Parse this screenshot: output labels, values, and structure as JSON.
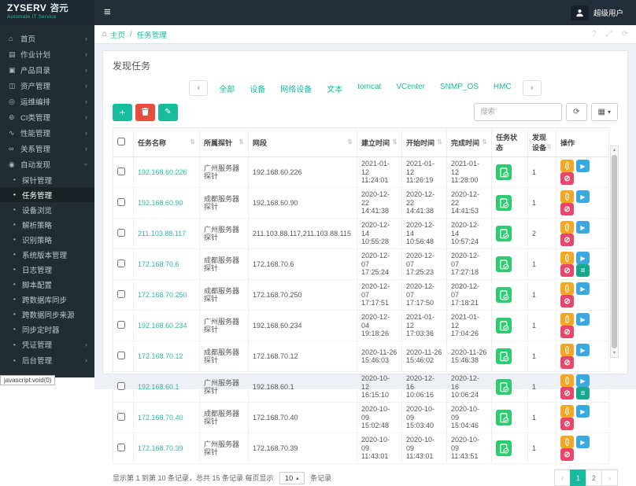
{
  "colors": {
    "accent": "#18bc9c",
    "link_teal": "#2fb9a4",
    "topbar_bg": "#232f38",
    "sidebar_bg": "#222d32",
    "content_bg": "#edf0f5",
    "danger_red": "#e74c3c",
    "op_orange": "#f5a623",
    "op_blue": "#3ba9e0",
    "op_red": "#e8476b",
    "op_teal": "#18a88c",
    "status_green": "#2ecc71"
  },
  "icons": {
    "hamburger": "≡",
    "chevron": "›",
    "bullet": "•",
    "sort": "⇅",
    "plus": "+",
    "pencil": "✎",
    "play": "▶",
    "ban": "⊘",
    "menu": "≡",
    "refresh": "⟳",
    "grid": "▦",
    "caret_down": "▾",
    "caret_up": "▴",
    "help": "?",
    "fullscreen": "⤢",
    "home": "⌂",
    "separator": "/"
  },
  "topbar": {
    "logo_en": "ZYSERV",
    "logo_cn": "咨元",
    "logo_subtitle": "Automate IT Service",
    "user": "超级用户"
  },
  "breadcrumb": {
    "home": "主页",
    "current": "任务管理"
  },
  "page": {
    "title": "发现任务"
  },
  "filter_tabs": {
    "prev": "‹",
    "next": "›",
    "items": [
      "全部",
      "设备",
      "网络设备",
      "文本",
      "tomcat",
      "VCenter",
      "SNMP_OS",
      "HMC"
    ]
  },
  "toolbar": {
    "search_placeholder": "搜索"
  },
  "sidebar": {
    "active_child": "任务管理",
    "items": [
      {
        "id": "home",
        "label": "首页",
        "glyph": "⌂",
        "icon": "home-icon",
        "chevron": true
      },
      {
        "id": "job-plan",
        "label": "作业计划",
        "glyph": "▤",
        "icon": "calendar-icon",
        "chevron": true
      },
      {
        "id": "product-catalog",
        "label": "产品目录",
        "glyph": "▣",
        "icon": "box-icon",
        "chevron": true
      },
      {
        "id": "asset-mgmt",
        "label": "资产管理",
        "glyph": "◫",
        "icon": "archive-icon",
        "chevron": true
      },
      {
        "id": "ops-orchestration",
        "label": "运维编排",
        "glyph": "◎",
        "icon": "orchestration-icon",
        "chevron": true
      },
      {
        "id": "ci-class",
        "label": "CI类管理",
        "glyph": "⊚",
        "icon": "share-icon",
        "chevron": true
      },
      {
        "id": "performance",
        "label": "性能管理",
        "glyph": "∿",
        "icon": "chart-icon",
        "chevron": true
      },
      {
        "id": "relation",
        "label": "关系管理",
        "glyph": "∞",
        "icon": "link-icon",
        "chevron": true
      },
      {
        "id": "auto-discovery",
        "label": "自动发现",
        "glyph": "◉",
        "icon": "eye-icon",
        "chevron": true,
        "expanded": true,
        "children": [
          "探针管理",
          "任务管理",
          "设备浏览",
          "解析策略",
          "识别策略",
          "系统版本管理",
          "日志管理",
          "脚本配置",
          "跨数据库同步",
          "跨数据同步来源",
          "同步定时器"
        ]
      },
      {
        "id": "credential",
        "label": "凭证管理",
        "glyph": "•",
        "icon": "key-icon",
        "chevron": true,
        "bullet": true
      },
      {
        "id": "backend",
        "label": "后台管理",
        "glyph": "•",
        "icon": "gear-icon",
        "chevron": true,
        "bullet": true
      }
    ]
  },
  "table": {
    "columns": [
      {
        "id": "name",
        "label": "任务名称",
        "sortable": true
      },
      {
        "id": "probe",
        "label": "所属探针",
        "sortable": true
      },
      {
        "id": "segment",
        "label": "网段",
        "sortable": true
      },
      {
        "id": "created",
        "label": "建立时间",
        "sortable": true
      },
      {
        "id": "started",
        "label": "开始时间",
        "sortable": true
      },
      {
        "id": "finished",
        "label": "完成时间",
        "sortable": true
      },
      {
        "id": "status",
        "label": "任务状态",
        "sortable": false
      },
      {
        "id": "devices",
        "label": "发现设备",
        "sortable": true
      },
      {
        "id": "ops",
        "label": "操作",
        "sortable": false
      }
    ],
    "rows": [
      {
        "name": "192.168.60.226",
        "probe": "广州服务器探针",
        "segment": "192.168.60.226",
        "created": "2021-01-12 11:24:01",
        "started": "2021-01-12 11:26:19",
        "finished": "2021-01-12 11:28:00",
        "status": "success",
        "devices": "1",
        "has_menu": false
      },
      {
        "name": "192.168.60.90",
        "probe": "成都服务器探针",
        "segment": "192.168.60.90",
        "created": "2020-12-22 14:41:38",
        "started": "2020-12-22 14:41:38",
        "finished": "2020-12-22 14:41:53",
        "status": "success",
        "devices": "1",
        "has_menu": false
      },
      {
        "name": "211.103.88.117",
        "probe": "广州服务器探针",
        "segment": "211.103.88.117,211.103.88.115",
        "created": "2020-12-14 10:55:28",
        "started": "2020-12-14 10:56:48",
        "finished": "2020-12-14 10:57:24",
        "status": "success",
        "devices": "2",
        "has_menu": false
      },
      {
        "name": "172.168.70.6",
        "probe": "成都服务器探针",
        "segment": "172.168.70.6",
        "created": "2020-12-07 17:25:24",
        "started": "2020-12-07 17:25:23",
        "finished": "2020-12-07 17:27:18",
        "status": "success",
        "devices": "1",
        "has_menu": true
      },
      {
        "name": "172.168.70.250",
        "probe": "成都服务器探针",
        "segment": "172.168.70.250",
        "created": "2020-12-07 17:17:51",
        "started": "2020-12-07 17:17:50",
        "finished": "2020-12-07 17:18:21",
        "status": "success",
        "devices": "1",
        "has_menu": false
      },
      {
        "name": "192.168.60.234",
        "probe": "广州服务器探针",
        "segment": "192.168.60.234",
        "created": "2020-12-04 19:18:26",
        "started": "2021-01-12 17:03:36",
        "finished": "2021-01-12 17:04:26",
        "status": "success",
        "devices": "1",
        "has_menu": false
      },
      {
        "name": "172.168.70.12",
        "probe": "成都服务器探针",
        "segment": "172.168.70.12",
        "created": "2020-11-26 15:46:03",
        "started": "2020-11-26 15:46:02",
        "finished": "2020-11-26 15:46:38",
        "status": "success",
        "devices": "1",
        "has_menu": false
      },
      {
        "name": "192.168.60.1",
        "probe": "广州服务器探针",
        "segment": "192.168.60.1",
        "created": "2020-10-12 16:15:10",
        "started": "2020-12-16 10:06:16",
        "finished": "2020-12-16 10:06:24",
        "status": "success",
        "devices": "1",
        "has_menu": true
      },
      {
        "name": "172.168.70.40",
        "probe": "成都服务器探针",
        "segment": "172.168.70.40",
        "created": "2020-10-09 15:02:48",
        "started": "2020-10-09 15:03:40",
        "finished": "2020-10-09 15:04:46",
        "status": "success",
        "devices": "1",
        "has_menu": false
      },
      {
        "name": "172.168.70.39",
        "probe": "广州服务器探针",
        "segment": "172.168.70.39",
        "created": "2020-10-09 11:43:01",
        "started": "2020-10-09 11:43:01",
        "finished": "2020-10-09 11:43:51",
        "status": "success",
        "devices": "1",
        "has_menu": false
      }
    ]
  },
  "footer": {
    "summary_prefix": "显示第 1 到第 10 条记录，总共 15 条记录 每页显示",
    "page_size": "10",
    "summary_suffix": "条记录"
  },
  "pagination": {
    "prev": "‹",
    "next": "›",
    "pages": [
      "1",
      "2"
    ],
    "active": "1"
  },
  "statusbar": {
    "text": "javascript:void(0)"
  }
}
